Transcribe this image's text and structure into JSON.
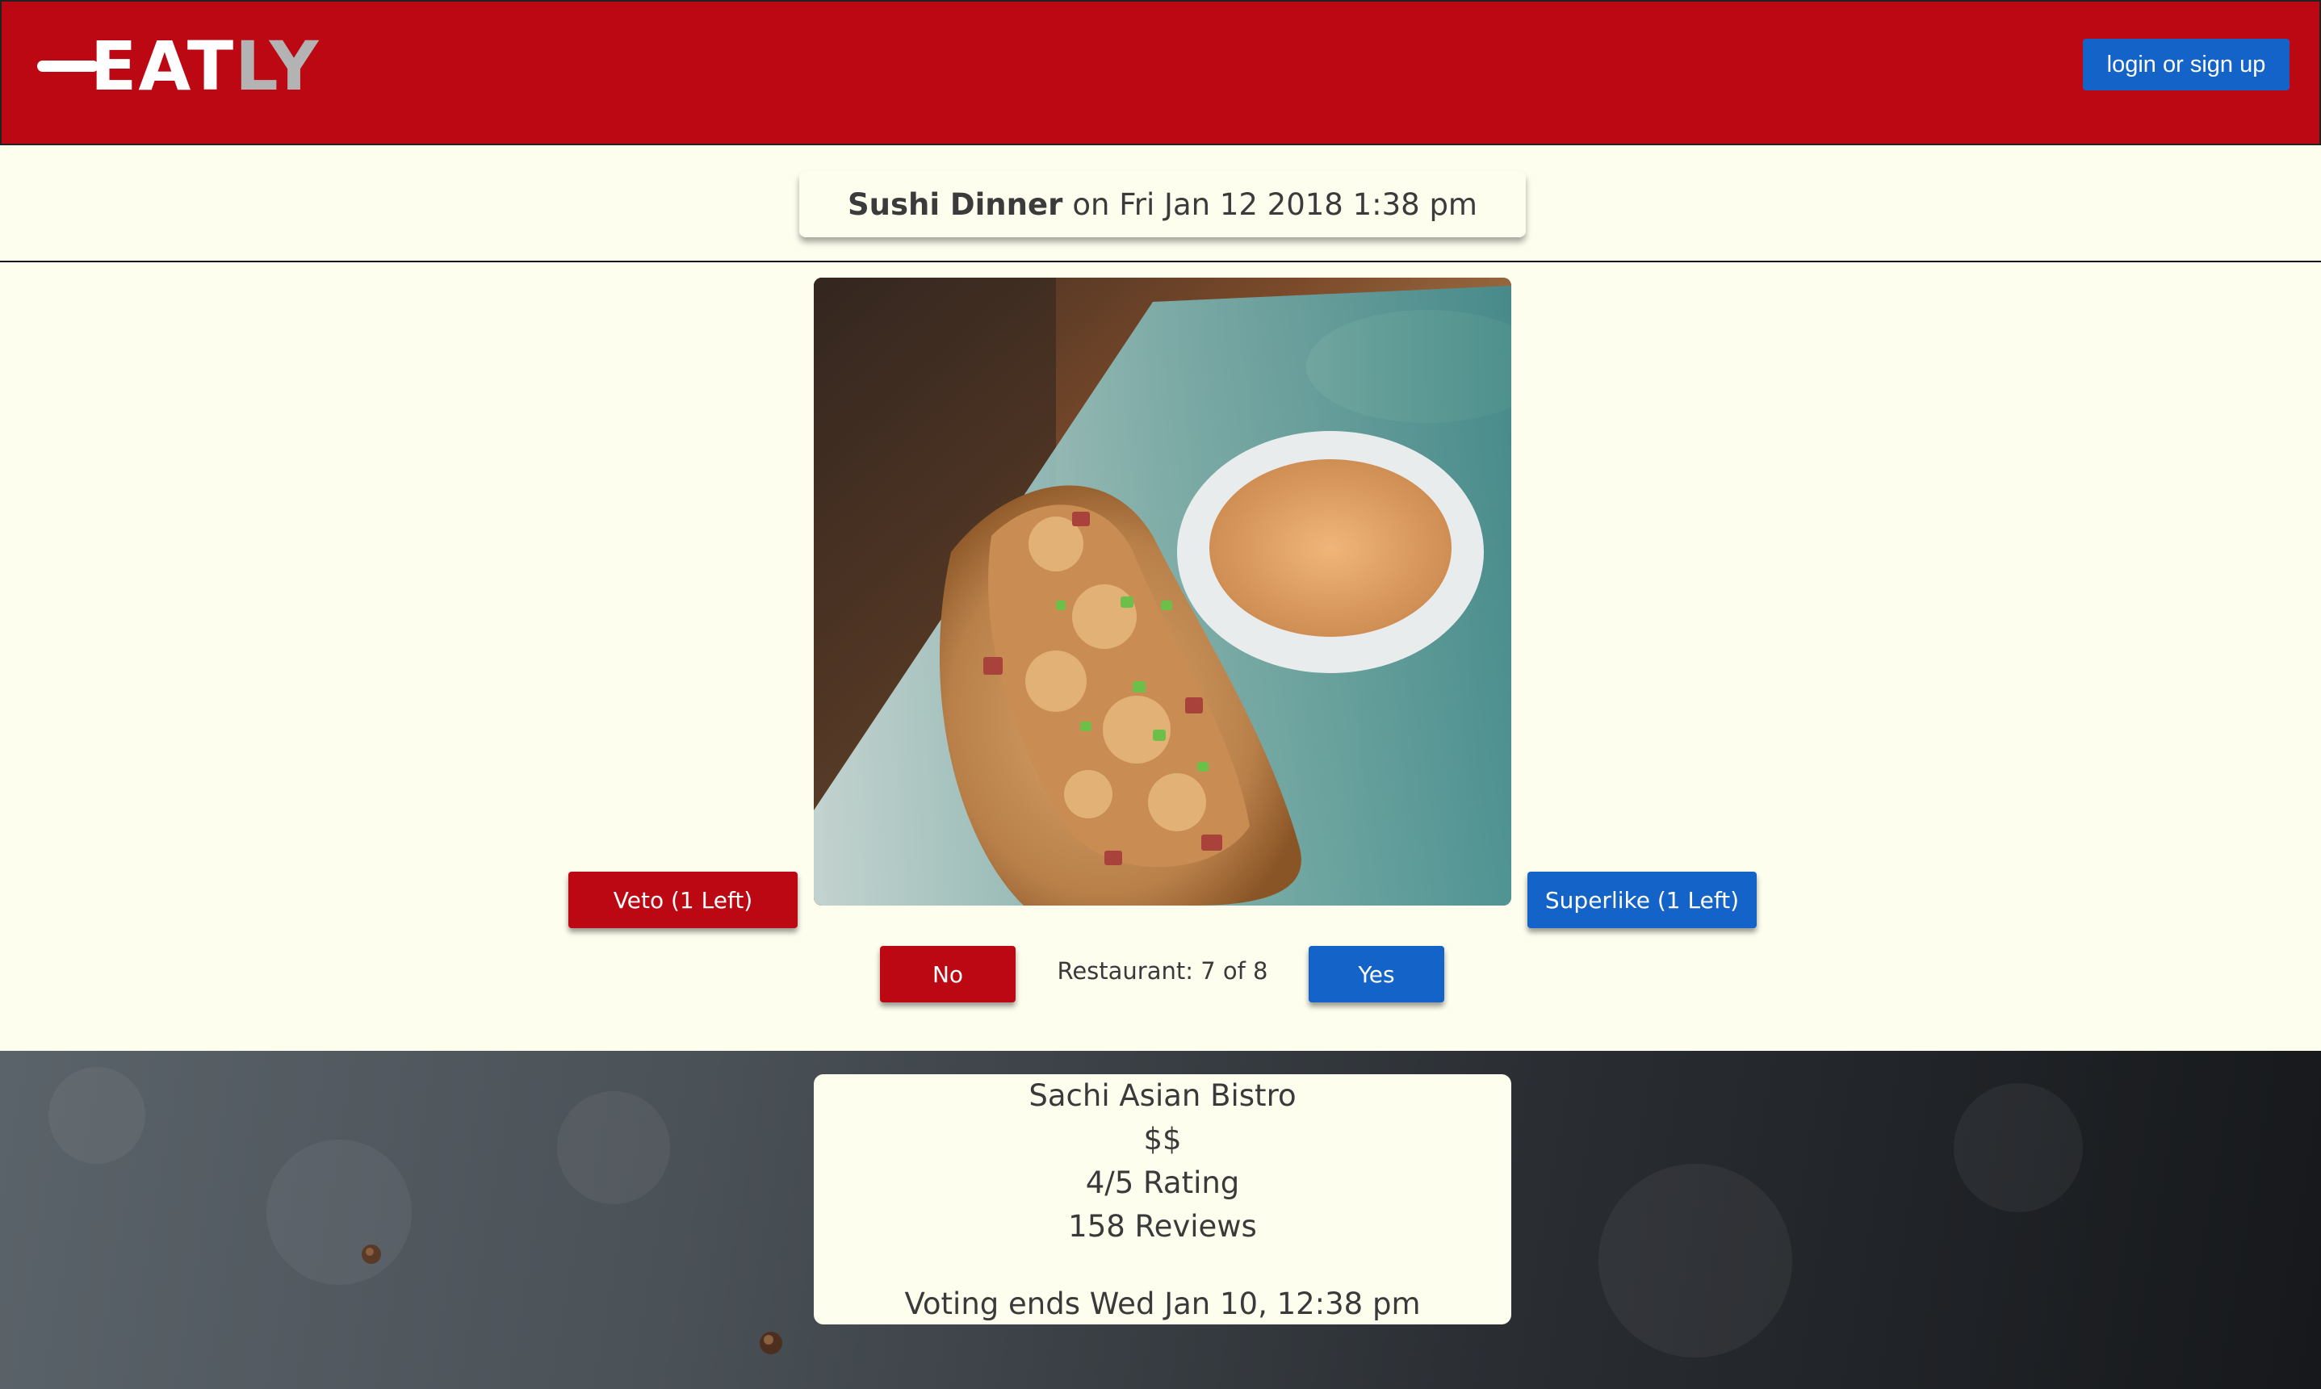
{
  "header": {
    "logo_text_white": "EAT",
    "logo_text_grey": "LY",
    "login_label": "login or sign up"
  },
  "event": {
    "name": "Sushi Dinner",
    "date_text": "on Fri Jan 12 2018 1:38 pm"
  },
  "voting": {
    "veto_label": "Veto (1 Left)",
    "superlike_label": "Superlike (1 Left)",
    "no_label": "No",
    "yes_label": "Yes",
    "counter_text": "Restaurant: 7 of 8"
  },
  "restaurant": {
    "name": "Sachi Asian Bistro",
    "price": "$$",
    "rating": "4/5 Rating",
    "reviews": "158 Reviews",
    "deadline": "Voting ends Wed Jan 10, 12:38 pm"
  },
  "colors": {
    "brand_red": "#bb0812",
    "action_blue": "#1463c8",
    "background_cream": "#fefeef"
  }
}
